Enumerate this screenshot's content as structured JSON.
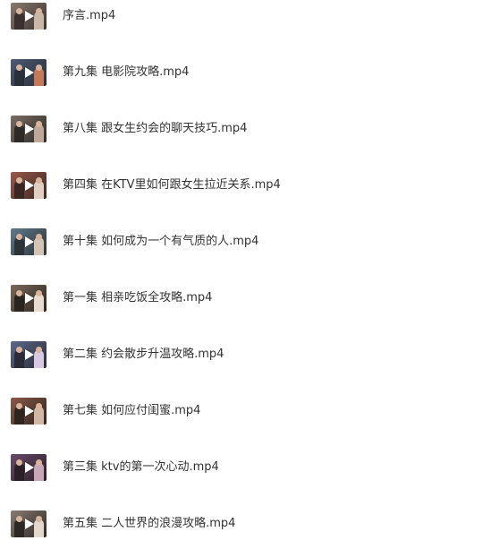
{
  "files": [
    {
      "name": "序言.mp4",
      "thumb": {
        "bg": "#8a7a6e",
        "tone": "#3a3130",
        "accent": "#c9b8a8"
      }
    },
    {
      "name": "第九集 电影院攻略.mp4",
      "thumb": {
        "bg": "#4d5a74",
        "tone": "#2a2f3a",
        "accent": "#c47a5a"
      }
    },
    {
      "name": "第八集 跟女生约会的聊天技巧.mp4",
      "thumb": {
        "bg": "#7c6e66",
        "tone": "#2e2a28",
        "accent": "#bfa898"
      }
    },
    {
      "name": "第四集 在KTV里如何跟女生拉近关系.mp4",
      "thumb": {
        "bg": "#9a5a4a",
        "tone": "#3a2622",
        "accent": "#e0d0c4"
      }
    },
    {
      "name": "第十集 如何成为一个有气质的人.mp4",
      "thumb": {
        "bg": "#5f7a8c",
        "tone": "#2d3338",
        "accent": "#d4c4b4"
      }
    },
    {
      "name": "第一集 相亲吃饭全攻略.mp4",
      "thumb": {
        "bg": "#7a6a5a",
        "tone": "#2a2420",
        "accent": "#e8dcd0"
      }
    },
    {
      "name": "第二集 约会散步升温攻略.mp4",
      "thumb": {
        "bg": "#5c6a8a",
        "tone": "#2a2c38",
        "accent": "#d8c8e0"
      }
    },
    {
      "name": "第七集 如何应付闺蜜.mp4",
      "thumb": {
        "bg": "#8a5a46",
        "tone": "#2e2420",
        "accent": "#d0b8a4"
      }
    },
    {
      "name": "第三集 ktv的第一次心动.mp4",
      "thumb": {
        "bg": "#6a4a6a",
        "tone": "#2a2028",
        "accent": "#c8a8b8"
      }
    },
    {
      "name": "第五集 二人世界的浪漫攻略.mp4",
      "thumb": {
        "bg": "#8a7c72",
        "tone": "#2c2826",
        "accent": "#e4d8cc"
      }
    }
  ]
}
